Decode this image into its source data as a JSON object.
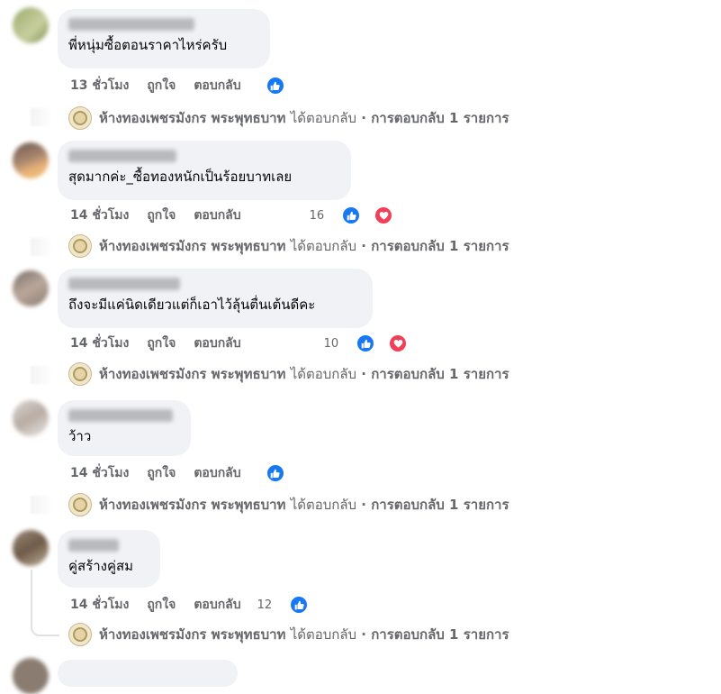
{
  "comments": [
    {
      "text": "พี่หนุ่มซื้อตอนราคาไหร่ครับ",
      "time": "13 ชั่วโมง",
      "like": "ถูกใจ",
      "reply": "ตอบกลับ",
      "reaction_count": "",
      "reactions": [
        "like-icon"
      ],
      "replier": "ห้างทองเพชรมังกร พระพุทธบาท",
      "replied": "ได้ตอบกลับ",
      "reply_summary": "· การตอบกลับ 1 รายการ"
    },
    {
      "text": "สุดมากค่ะ_ซื้อทองหนักเป็นร้อยบาทเลย",
      "time": "14 ชั่วโมง",
      "like": "ถูกใจ",
      "reply": "ตอบกลับ",
      "reaction_count": "16",
      "reactions": [
        "like-icon",
        "love-icon"
      ],
      "replier": "ห้างทองเพชรมังกร พระพุทธบาท",
      "replied": "ได้ตอบกลับ",
      "reply_summary": "· การตอบกลับ 1 รายการ"
    },
    {
      "text": "ถึงจะมีแค่นิดเดียวแต่ก็เอาไว้ลุ้นตื่นเต้นดีคะ",
      "time": "14 ชั่วโมง",
      "like": "ถูกใจ",
      "reply": "ตอบกลับ",
      "reaction_count": "10",
      "reactions": [
        "like-icon",
        "love-icon"
      ],
      "replier": "ห้างทองเพชรมังกร พระพุทธบาท",
      "replied": "ได้ตอบกลับ",
      "reply_summary": "· การตอบกลับ 1 รายการ"
    },
    {
      "text": "ว้าว",
      "time": "14 ชั่วโมง",
      "like": "ถูกใจ",
      "reply": "ตอบกลับ",
      "reaction_count": "",
      "reactions": [
        "like-icon"
      ],
      "replier": "ห้างทองเพชรมังกร พระพุทธบาท",
      "replied": "ได้ตอบกลับ",
      "reply_summary": "· การตอบกลับ 1 รายการ"
    },
    {
      "text": "คู่สร้างคู่สม",
      "time": "14 ชั่วโมง",
      "like": "ถูกใจ",
      "reply": "ตอบกลับ",
      "reaction_count": "12",
      "reactions": [
        "like-icon"
      ],
      "replier": "ห้างทองเพชรมังกร พระพุทธบาท",
      "replied": "ได้ตอบกลับ",
      "reply_summary": "· การตอบกลับ 1 รายการ"
    }
  ],
  "colors": {
    "like": "#1877f2",
    "love": "#f33e58",
    "bubble": "#f0f2f5",
    "meta": "#65676b"
  }
}
